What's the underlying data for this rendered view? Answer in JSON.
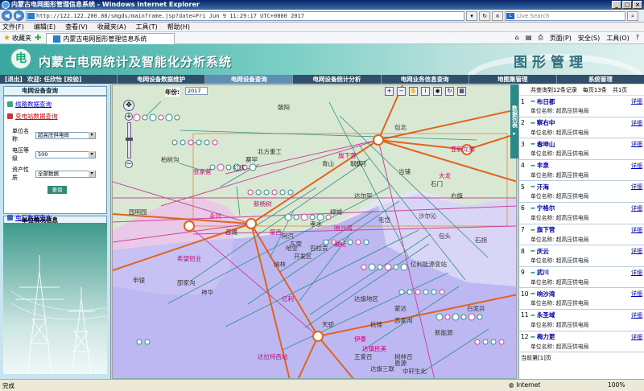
{
  "browser": {
    "title": "内蒙古电网图形管理信息系统 - Windows Internet Explorer",
    "url": "http://122.122.200.88/smgds/mainframe.jsp?date=Fri Jun 9 11:29:17 UTC+0800 2017",
    "search_placeholder": "Live Search",
    "menu": [
      "文件(F)",
      "编辑(E)",
      "查看(V)",
      "收藏夹(A)",
      "工具(T)",
      "帮助(H)"
    ],
    "favorites_label": "收藏夹",
    "tab_title": "内蒙古电网图形管理信息系统",
    "tools": [
      "页面(P)",
      "安全(S)",
      "工具(O)"
    ]
  },
  "app": {
    "title": "内蒙古电网统计及智能化分析系统",
    "subtitle": "图形管理",
    "logo_text": "电"
  },
  "nav": {
    "logout": "[退出]",
    "welcome": "欢迎: 任欣怡 [校验]",
    "tabs": [
      "电网设备数据维护",
      "电网设备查询",
      "电网设备统计分析",
      "电网业务信息查询",
      "地图集管理",
      "系统管理"
    ]
  },
  "left": {
    "header": "电网设备查询",
    "links": [
      "线路数据查询",
      "变电站数据查询"
    ],
    "form": [
      {
        "label": "单位名称",
        "value": "超高压供电局"
      },
      {
        "label": "电压等级",
        "value": "500"
      },
      {
        "label": "资产性质",
        "value": "全部数据"
      }
    ],
    "query_button": "查询",
    "plant_link": "电厂数据查询",
    "unit_info": "单位情况信息"
  },
  "map": {
    "year_label": "年份:",
    "year_value": "2017",
    "labels": [
      {
        "t": "朝阳",
        "c": "#333"
      },
      {
        "t": "包北",
        "c": "#333"
      },
      {
        "t": "旗下营",
        "c": "#c07"
      },
      {
        "t": "达尔罕",
        "c": "#333"
      },
      {
        "t": "北方重工",
        "c": "#333"
      },
      {
        "t": "亚新龙顺",
        "c": "#c07"
      },
      {
        "t": "张家营",
        "c": "#c07"
      },
      {
        "t": "红庆",
        "c": "#333"
      },
      {
        "t": "赛罕",
        "c": "#333"
      },
      {
        "t": "青山",
        "c": "#333"
      },
      {
        "t": "耿庆",
        "c": "#333"
      },
      {
        "t": "当铺",
        "c": "#333"
      },
      {
        "t": "召滩",
        "c": "#333"
      },
      {
        "t": "阿汽",
        "c": "#333"
      },
      {
        "t": "孝水",
        "c": "#333"
      },
      {
        "t": "绿城",
        "c": "#333"
      },
      {
        "t": "石门",
        "c": "#333"
      },
      {
        "t": "哈业",
        "c": "#333"
      },
      {
        "t": "响沙湾",
        "c": "#c07"
      },
      {
        "t": "东荣",
        "c": "#333"
      },
      {
        "t": "蒙西",
        "c": "#c07"
      },
      {
        "t": "碱柜",
        "c": "#c07"
      },
      {
        "t": "巴拉贡",
        "c": "#333"
      },
      {
        "t": "开发区",
        "c": "#333"
      },
      {
        "t": "新杨树",
        "c": "#c07"
      },
      {
        "t": "亿利能源变站",
        "c": "#333"
      },
      {
        "t": "希望铝业",
        "c": "#c07"
      },
      {
        "t": "蒙达",
        "c": "#333"
      },
      {
        "t": "达旗地区",
        "c": "#333"
      },
      {
        "t": "亿利",
        "c": "#c07"
      },
      {
        "t": "杭锦",
        "c": "#333"
      },
      {
        "t": "天骄",
        "c": "#333"
      },
      {
        "t": "达拉特西站",
        "c": "#c07"
      },
      {
        "t": "苏家沟",
        "c": "#333"
      },
      {
        "t": "伊泰",
        "c": "#c07"
      },
      {
        "t": "达镇民美",
        "c": "#c07"
      },
      {
        "t": "王爱召",
        "c": "#333"
      },
      {
        "t": "恩源",
        "c": "#333"
      },
      {
        "t": "达旗三联",
        "c": "#333"
      },
      {
        "t": "树林召",
        "c": "#333"
      },
      {
        "t": "中轩生化",
        "c": "#333"
      },
      {
        "t": "新能源",
        "c": "#333"
      },
      {
        "t": "白泥井",
        "c": "#333"
      },
      {
        "t": "包头",
        "c": "#333"
      },
      {
        "t": "石拐",
        "c": "#333"
      },
      {
        "t": "柏树沟",
        "c": "#333"
      },
      {
        "t": "永兴",
        "c": "#c07"
      },
      {
        "t": "沙河",
        "c": "#333"
      },
      {
        "t": "右旗",
        "c": "#333"
      },
      {
        "t": "沙尔沁",
        "c": "#333"
      },
      {
        "t": "毛岱",
        "c": "#333"
      },
      {
        "t": "园明园",
        "c": "#333"
      },
      {
        "t": "申银",
        "c": "#333"
      },
      {
        "t": "邵家沟",
        "c": "#333"
      },
      {
        "t": "神华",
        "c": "#333"
      },
      {
        "t": "纳林",
        "c": "#333"
      },
      {
        "t": "大龙",
        "c": "#c07"
      }
    ]
  },
  "list": {
    "toggle": "数据列表",
    "summary": [
      "共查询到12条记录",
      "每页13条",
      "共1页"
    ],
    "items": [
      {
        "no": "1",
        "name": "布日都",
        "unit": "单位名称: 超高压供电局"
      },
      {
        "no": "2",
        "name": "察右中",
        "unit": "单位名称: 超高压供电局"
      },
      {
        "no": "3",
        "name": "春坤山",
        "unit": "单位名称: 超高压供电局"
      },
      {
        "no": "4",
        "name": "丰泉",
        "unit": "单位名称: 超高压供电局"
      },
      {
        "no": "5",
        "name": "汗海",
        "unit": "单位名称: 超高压供电局"
      },
      {
        "no": "6",
        "name": "宁格尔",
        "unit": "单位名称: 超高压供电局"
      },
      {
        "no": "7",
        "name": "旗下营",
        "unit": "单位名称: 超高压供电局"
      },
      {
        "no": "8",
        "name": "庆云",
        "unit": "单位名称: 超高压供电局"
      },
      {
        "no": "9",
        "name": "武川",
        "unit": "单位名称: 超高压供电局"
      },
      {
        "no": "10",
        "name": "响沙湾",
        "unit": "单位名称: 超高压供电局"
      },
      {
        "no": "11",
        "name": "永圣域",
        "unit": "单位名称: 超高压供电局"
      },
      {
        "no": "12",
        "name": "梅力更",
        "unit": "单位名称: 超高压供电局"
      }
    ],
    "detail_label": "详细",
    "footer": "当前第[1]页"
  },
  "status": {
    "text": "完成",
    "zone": "Internet",
    "zoom": "100%"
  },
  "colors": {
    "header_teal": "#3aa8a0",
    "nav_bg": "#2f4f6a",
    "map_land": "#e0e8f0",
    "map_green": "#d6e6cf",
    "map_purple": "#bdb8f2",
    "line_orange": "#e0641e",
    "line_pink": "#c8479a",
    "line_teal": "#2f8f8a"
  }
}
